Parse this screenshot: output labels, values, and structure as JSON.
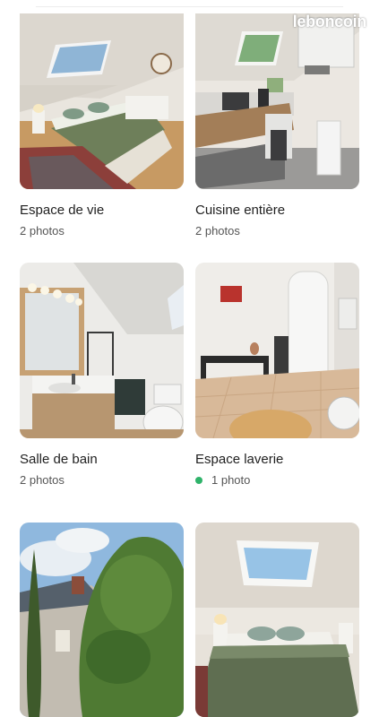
{
  "watermark": "leboncoin",
  "colors": {
    "status_green": "#2fb36a"
  },
  "gallery": {
    "categories": [
      {
        "title": "Espace de vie",
        "count": "2 photos"
      },
      {
        "title": "Cuisine entière",
        "count": "2 photos"
      },
      {
        "title": "Salle de bain",
        "count": "2 photos"
      },
      {
        "title": "Espace laverie",
        "count": "1 photo",
        "status_dot": true
      },
      {
        "title": "",
        "count": ""
      },
      {
        "title": "",
        "count": ""
      }
    ]
  }
}
